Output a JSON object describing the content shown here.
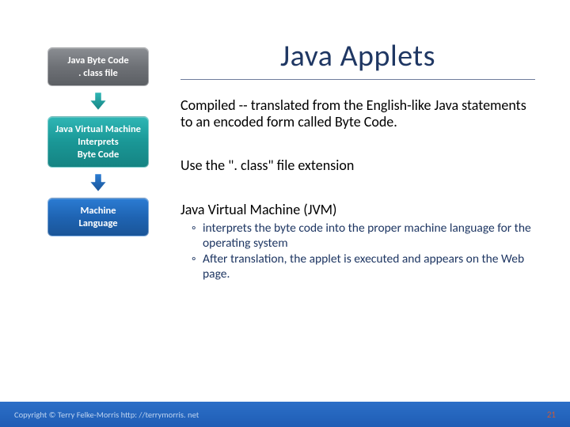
{
  "title": "Java Applets",
  "flow": {
    "box1_line1": "Java Byte Code",
    "box1_line2": ". class file",
    "box2_line1": "Java Virtual Machine",
    "box2_line2": "Interprets",
    "box2_line3": "Byte Code",
    "box3_line1": "Machine",
    "box3_line2": "Language"
  },
  "body": {
    "p1": "Compiled -- translated from the English-like Java statements to an encoded form called Byte Code.",
    "p2": "Use the \". class\" file extension",
    "p3_heading": "Java Virtual Machine (JVM)",
    "p3_sub1": "interprets the byte code into the proper machine language for the operating system",
    "p3_sub2": "After translation, the applet is executed and appears on the Web page."
  },
  "footer": {
    "copyright": "Copyright © Terry Felke-Morris http: //terrymorris. net",
    "page": "21"
  }
}
